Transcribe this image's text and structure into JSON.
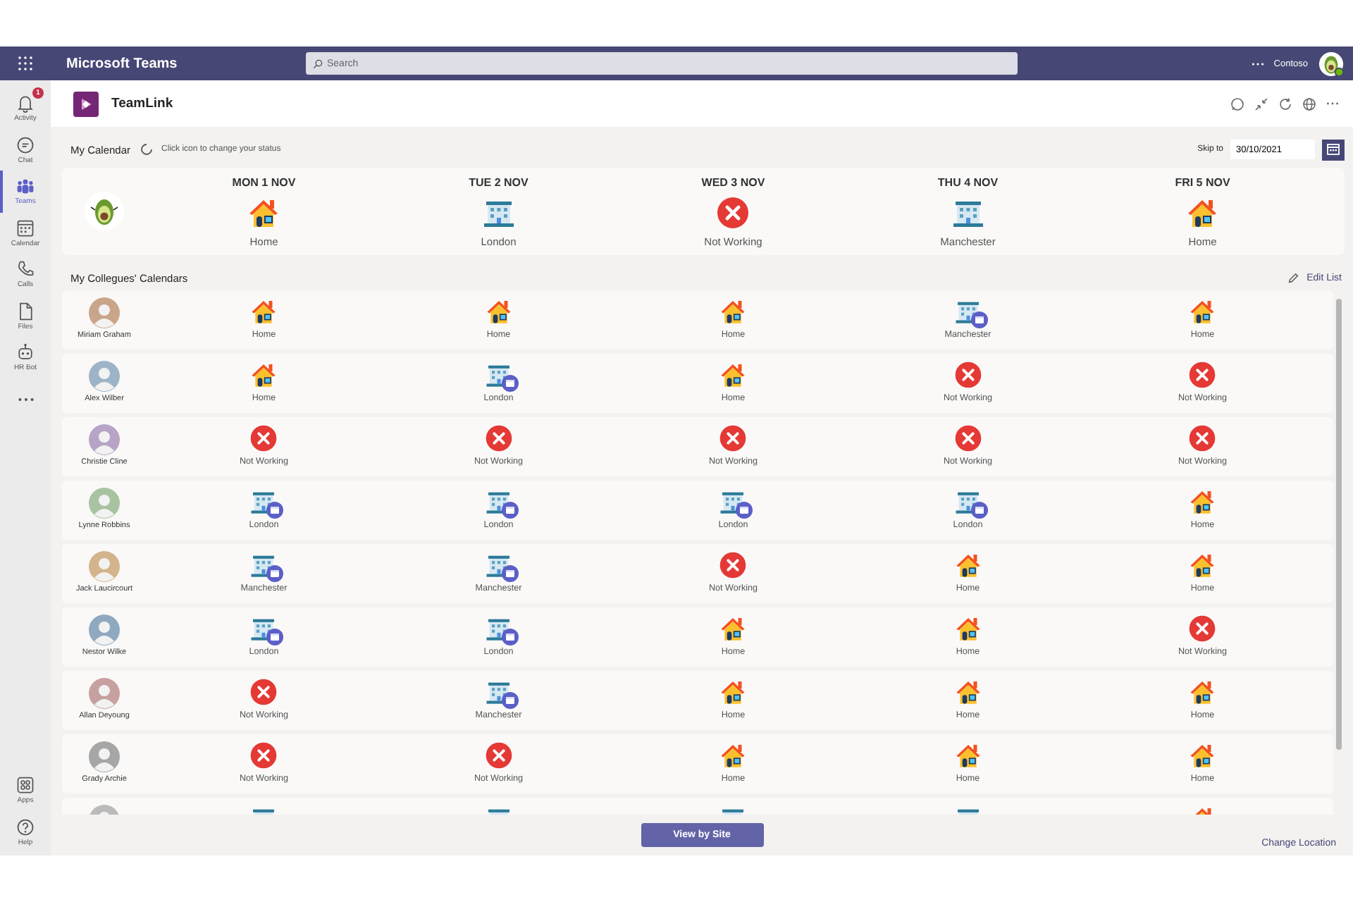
{
  "app": {
    "name": "Microsoft Teams"
  },
  "search": {
    "placeholder": "Search"
  },
  "account": {
    "org": "Contoso"
  },
  "rail": [
    {
      "kind": "bell",
      "label": "Activity",
      "badge": "1",
      "selected": false
    },
    {
      "kind": "chat",
      "label": "Chat",
      "selected": false
    },
    {
      "kind": "teams",
      "label": "Teams",
      "selected": true
    },
    {
      "kind": "calendar",
      "label": "Calendar",
      "selected": false
    },
    {
      "kind": "calls",
      "label": "Calls",
      "selected": false
    },
    {
      "kind": "files",
      "label": "Files",
      "selected": false
    },
    {
      "kind": "bot",
      "label": "HR Bot",
      "selected": false
    },
    {
      "kind": "more",
      "selected": false
    }
  ],
  "rail_bottom": [
    {
      "kind": "apps",
      "label": "Apps",
      "selected": false
    },
    {
      "kind": "help",
      "label": "Help",
      "selected": false
    }
  ],
  "tab": {
    "title": "TeamLink"
  },
  "my_calendar": {
    "title": "My Calendar",
    "hint": "Click icon to change your status",
    "skip_label": "Skip to",
    "date": "30/10/2021",
    "days": [
      {
        "day": "MON 1 NOV",
        "kind": "home",
        "label": "Home"
      },
      {
        "day": "TUE 2 NOV",
        "kind": "office",
        "label": "London"
      },
      {
        "day": "WED 3 NOV",
        "kind": "off",
        "label": "Not Working"
      },
      {
        "day": "THU 4 NOV",
        "kind": "office",
        "label": "Manchester"
      },
      {
        "day": "FRI 5 NOV",
        "kind": "home",
        "label": "Home"
      }
    ]
  },
  "colleagues": {
    "title": "My Collegues' Calendars",
    "edit": "Edit List",
    "rows": [
      {
        "name": "Miriam Graham",
        "days": [
          {
            "kind": "home",
            "label": "Home"
          },
          {
            "kind": "home",
            "label": "Home"
          },
          {
            "kind": "home",
            "label": "Home"
          },
          {
            "kind": "office",
            "label": "Manchester"
          },
          {
            "kind": "home",
            "label": "Home"
          }
        ]
      },
      {
        "name": "Alex Wilber",
        "days": [
          {
            "kind": "home",
            "label": "Home"
          },
          {
            "kind": "office",
            "label": "London"
          },
          {
            "kind": "home",
            "label": "Home"
          },
          {
            "kind": "off",
            "label": "Not Working"
          },
          {
            "kind": "off",
            "label": "Not Working"
          }
        ]
      },
      {
        "name": "Christie Cline",
        "days": [
          {
            "kind": "off",
            "label": "Not Working"
          },
          {
            "kind": "off",
            "label": "Not Working"
          },
          {
            "kind": "off",
            "label": "Not Working"
          },
          {
            "kind": "off",
            "label": "Not Working"
          },
          {
            "kind": "off",
            "label": "Not Working"
          }
        ]
      },
      {
        "name": "Lynne Robbins",
        "days": [
          {
            "kind": "office",
            "label": "London"
          },
          {
            "kind": "office",
            "label": "London"
          },
          {
            "kind": "office",
            "label": "London"
          },
          {
            "kind": "office",
            "label": "London"
          },
          {
            "kind": "home",
            "label": "Home"
          }
        ]
      },
      {
        "name": "Jack Laucircourt",
        "days": [
          {
            "kind": "office",
            "label": "Manchester"
          },
          {
            "kind": "office",
            "label": "Manchester"
          },
          {
            "kind": "off",
            "label": "Not Working"
          },
          {
            "kind": "home",
            "label": "Home"
          },
          {
            "kind": "home",
            "label": "Home"
          }
        ]
      },
      {
        "name": "Nestor Wilke",
        "days": [
          {
            "kind": "office",
            "label": "London"
          },
          {
            "kind": "office",
            "label": "London"
          },
          {
            "kind": "home",
            "label": "Home"
          },
          {
            "kind": "home",
            "label": "Home"
          },
          {
            "kind": "off",
            "label": "Not Working"
          }
        ]
      },
      {
        "name": "Allan Deyoung",
        "days": [
          {
            "kind": "off",
            "label": "Not Working"
          },
          {
            "kind": "office",
            "label": "Manchester"
          },
          {
            "kind": "home",
            "label": "Home"
          },
          {
            "kind": "home",
            "label": "Home"
          },
          {
            "kind": "home",
            "label": "Home"
          }
        ]
      },
      {
        "name": "Grady Archie",
        "days": [
          {
            "kind": "off",
            "label": "Not Working"
          },
          {
            "kind": "off",
            "label": "Not Working"
          },
          {
            "kind": "home",
            "label": "Home"
          },
          {
            "kind": "home",
            "label": "Home"
          },
          {
            "kind": "home",
            "label": "Home"
          }
        ]
      },
      {
        "days": [
          {
            "kind": "office"
          },
          {
            "kind": "office"
          },
          {
            "kind": "office"
          },
          {
            "kind": "office"
          },
          {
            "kind": "home"
          }
        ]
      }
    ]
  },
  "footer": {
    "button": "View by Site",
    "link": "Change Location"
  }
}
